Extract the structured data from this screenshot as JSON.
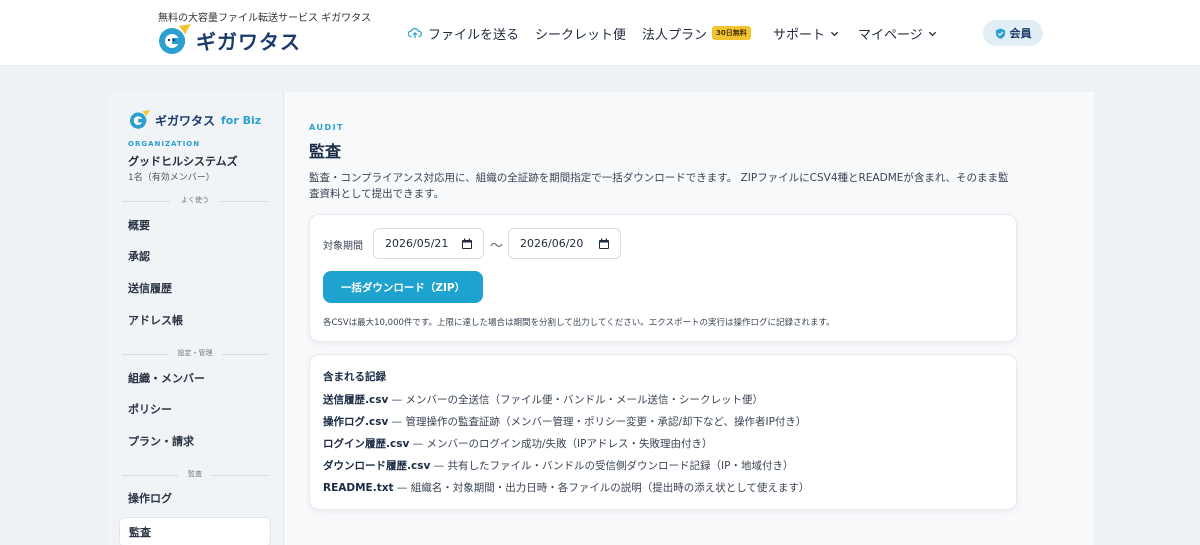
{
  "header": {
    "tagline": "無料の大容量ファイル転送サービス ギガワタス",
    "logo_text": "ギガワタス",
    "nav": {
      "send_files": "ファイルを送る",
      "secret": "シークレット便",
      "business_plan": "法人プラン",
      "business_badge": "30日無料",
      "support": "サポート",
      "mypage": "マイページ"
    },
    "member_label": "会員"
  },
  "sidebar": {
    "logo_text": "ギガワタス",
    "logo_suffix": "for Biz",
    "org_label": "ORGANIZATION",
    "org_name": "グッドヒルシステムズ",
    "org_count": "1名（有効メンバー）",
    "sections": {
      "frequent": "よく使う",
      "settings": "設定・管理",
      "audit": "監査"
    },
    "items": {
      "overview": "概要",
      "approval": "承認",
      "history": "送信履歴",
      "addressbook": "アドレス帳",
      "org_members": "組織・メンバー",
      "policy": "ポリシー",
      "plan_billing": "プラン・請求",
      "oplog": "操作ログ",
      "audit": "監査"
    }
  },
  "main": {
    "eyebrow": "AUDIT",
    "title": "監査",
    "description": "監査・コンプライアンス対応用に、組織の全証跡を期間指定で一括ダウンロードできます。 ZIPファイルにCSV4種とREADMEが含まれ、そのまま監査資料として提出できます。",
    "period_label": "対象期間",
    "date_from": "2026/05/21",
    "date_to": "2026/06/20",
    "tilde": "〜",
    "download_button": "一括ダウンロード（ZIP）",
    "note": "各CSVは最大10,000件です。上限に達した場合は期間を分割して出力してください。エクスポートの実行は操作ログに記録されます。",
    "records_title": "含まれる記録",
    "records": [
      {
        "file": "送信履歴.csv",
        "desc": " — メンバーの全送信（ファイル便・バンドル・メール送信・シークレット便）"
      },
      {
        "file": "操作ログ.csv",
        "desc": " — 管理操作の監査証跡（メンバー管理・ポリシー変更・承認/却下など、操作者IP付き）"
      },
      {
        "file": "ログイン履歴.csv",
        "desc": " — メンバーのログイン成功/失敗（IPアドレス・失敗理由付き）"
      },
      {
        "file": "ダウンロード履歴.csv",
        "desc": " — 共有したファイル・バンドルの受信側ダウンロード記録（IP・地域付き）"
      },
      {
        "file": "README.txt",
        "desc": " — 組織名・対象期間・出力日時・各ファイルの説明（提出時の添え状として使えます）"
      }
    ]
  },
  "colors": {
    "accent": "#1ea3cf",
    "brand_navy": "#1a3a6b",
    "badge_yellow": "#f4c430"
  },
  "icons": [
    "logo-icon",
    "cloud-upload-icon",
    "chevron-down-icon",
    "shield-check-icon",
    "calendar-icon"
  ]
}
